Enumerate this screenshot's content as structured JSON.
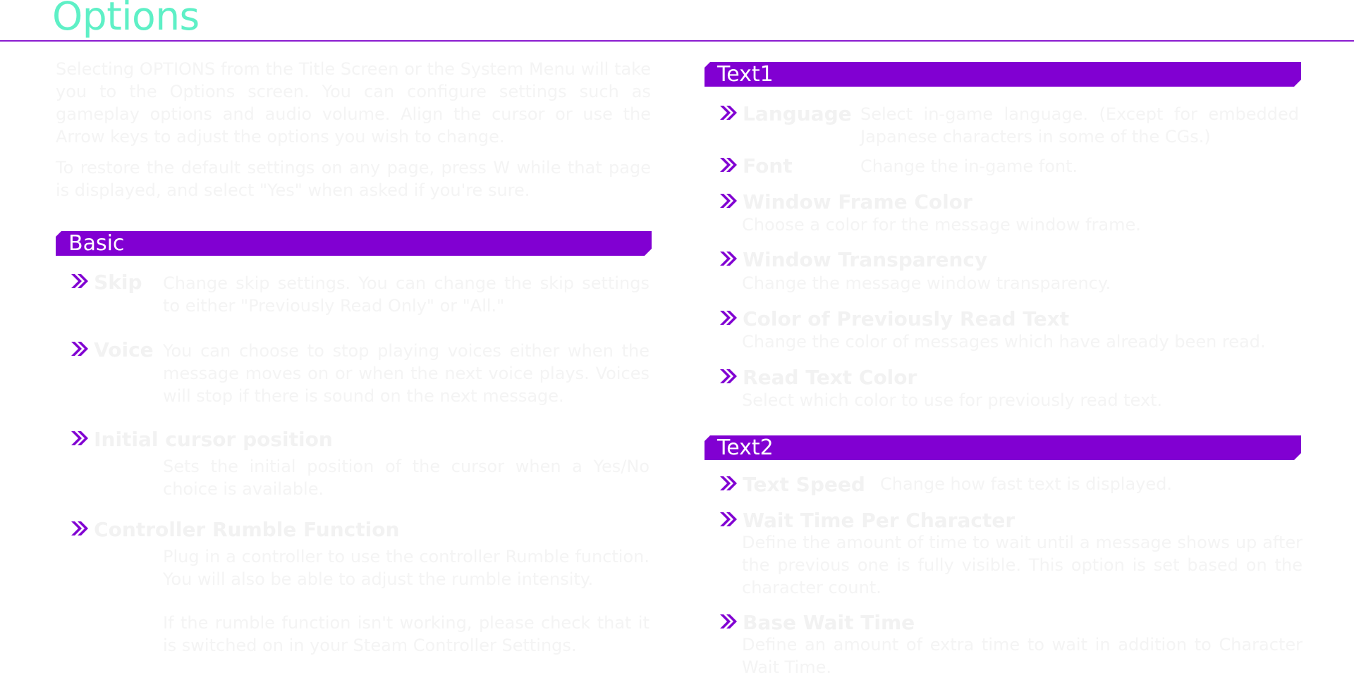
{
  "title": "Options",
  "intro": {
    "p1": "Selecting OPTIONS from the Title Screen or the System Menu will take you to the Options screen. You can configure settings such as gameplay options and audio volume. Align the cursor or use the Arrow keys to adjust the options you wish to change.",
    "p2": "To restore the default settings on any page, press W while that page is displayed, and select \"Yes\" when asked if you're sure."
  },
  "sections": {
    "basic": {
      "label": "Basic",
      "items": [
        {
          "name": "Skip",
          "desc": "Change skip settings. You can change the skip settings to either \"Previously Read Only\" or \"All.\""
        },
        {
          "name": "Voice",
          "desc": "You can choose to stop playing voices either when the message moves on or when the next voice plays. Voices will stop if there is sound on the next message."
        },
        {
          "name": "Initial cursor position",
          "desc": "Sets the initial position of the cursor when a Yes/No choice is available."
        },
        {
          "name": "Controller Rumble Function",
          "desc": "Plug in a controller to use the controller Rumble function. You will also be able to adjust the rumble intensity.",
          "desc2": "If the rumble function isn't working, please check that it is switched on in your Steam Controller Settings."
        }
      ]
    },
    "text1": {
      "label": "Text1",
      "items": [
        {
          "name": "Language",
          "desc": "Select in-game language. (Except for embedded Japanese characters in some of the CGs.)"
        },
        {
          "name": "Font",
          "desc": "Change the in-game font."
        },
        {
          "name": "Window Frame Color",
          "desc": "Choose a color for the message window frame."
        },
        {
          "name": "Window Transparency",
          "desc": "Change the message window transparency."
        },
        {
          "name": "Color of Previously Read Text",
          "desc": "Change the color of messages which have already been read."
        },
        {
          "name": "Read Text Color",
          "desc": "Select which color to use for previously read text."
        }
      ]
    },
    "text2": {
      "label": "Text2",
      "items": [
        {
          "name": "Text Speed",
          "desc": "Change how fast text is displayed."
        },
        {
          "name": "Wait Time Per Character",
          "desc": "Define the amount of time to wait until a message shows up after the previous one is fully visible. This option is set based on the character count."
        },
        {
          "name": "Base Wait Time",
          "desc": "Define an amount of extra time to wait in addition to Character Wait Time."
        }
      ]
    }
  },
  "colors": {
    "title": "#5ef0c6",
    "accent": "#8100d2",
    "faded_text": "#f2f2f2"
  },
  "icons": {
    "bullet": "double-chevron-icon"
  }
}
